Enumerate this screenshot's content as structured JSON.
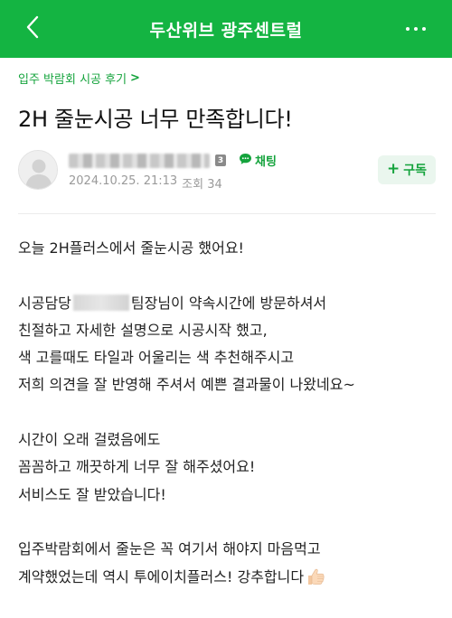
{
  "header": {
    "title": "두산위브 광주센트럴",
    "back_icon": "chevron-left-icon",
    "more_icon": "more-dots-icon",
    "bg_color": "#14b442"
  },
  "breadcrumb": {
    "label": "입주 박람회 시공 후기",
    "chevron": ">"
  },
  "post": {
    "title": "2H 줄눈시공 너무 만족합니다!"
  },
  "author": {
    "level": "3",
    "chat_label": "채팅",
    "date": "2024.10.25. 21:13",
    "views_label": "조회 34",
    "subscribe_label": "구독",
    "subscribe_plus": "+"
  },
  "content": {
    "p1": [
      "오늘 2H플러스에서 줄눈시공 했어요!"
    ],
    "p2_l1_before": "시공담당",
    "p2_l1_after": "팀장님이 약속시간에 방문하셔서",
    "p2": [
      "친절하고 자세한 설명으로 시공시작 했고,",
      "색 고를때도 타일과 어울리는 색 추천해주시고",
      "저희 의견을 잘 반영해 주셔서 예쁜 결과물이 나왔네요~"
    ],
    "p3": [
      "시간이 오래 걸렸음에도",
      "꼼꼼하고 깨끗하게 너무 잘 해주셨어요!",
      "서비스도 잘 받았습니다!"
    ],
    "p4_l1": "입주박람회에서 줄눈은 꼭 여기서 해야지 마음먹고",
    "p4_l2": "계약했었는데 역시 투에이치플러스! 강추합니다",
    "emoji": "thumbs-up-icon"
  }
}
